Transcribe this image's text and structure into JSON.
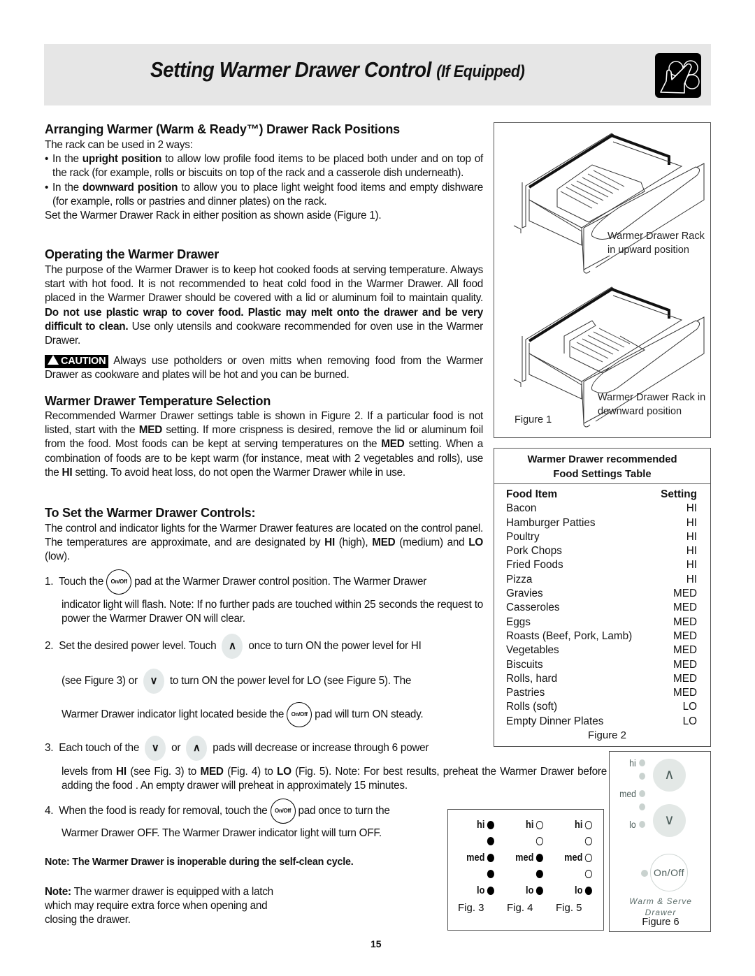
{
  "header": {
    "title_main": "Setting Warmer Drawer Control",
    "title_suffix": "(If Equipped)",
    "icon": "hand-touch-icon"
  },
  "section_rack": {
    "heading": "Arranging Warmer (Warm & Ready™) Drawer Rack Positions",
    "intro": "The rack can be used in 2 ways:",
    "bullet1_pre": "In the ",
    "bullet1_bold": "upright position",
    "bullet1_post": " to allow low profile food items to be placed both under and on top of the rack (for example, rolls or biscuits on top of the rack and a casserole dish underneath).",
    "bullet2_pre": "In the ",
    "bullet2_bold": "downward position",
    "bullet2_post": " to allow you to place light weight food items and empty dishware (for example, rolls or pastries and dinner plates) on the rack.",
    "closing": "Set the Warmer Drawer Rack in either position as shown aside (Figure 1)."
  },
  "section_operating": {
    "heading": "Operating the Warmer Drawer",
    "body_pre": "The purpose of the Warmer Drawer is to keep hot cooked foods at serving temperature. Always start with hot food. It is not recommended to heat cold food in the Warmer Drawer. All food placed in the Warmer Drawer should be covered with a lid or aluminum foil to maintain quality. ",
    "body_bold": "Do not use plastic wrap to cover food. Plastic may melt onto the drawer and be very difficult to clean.",
    "body_post": " Use only utensils and cookware recommended for oven use in the Warmer Drawer.",
    "caution_label": "CAUTION",
    "caution_text": " Always use potholders or oven mitts when removing food from the Warmer Drawer as cookware and plates will be hot and you can be burned."
  },
  "section_temperature": {
    "heading": "Warmer Drawer Temperature Selection",
    "t1": "Recommended Warmer Drawer settings table is shown in Figure 2. If a particular food is not listed, start with the ",
    "b1": "MED",
    "t2": " setting. If more crispness is desired, remove the lid or aluminum foil from the food. Most foods can be kept at serving temperatures on the ",
    "b2": "MED",
    "t3": " setting. When a combination of foods are to be kept warm (for instance, meat with 2 vegetables and rolls), use the ",
    "b3": "HI",
    "t4": " setting. To avoid heat loss, do not open the Warmer Drawer while in use."
  },
  "section_controls": {
    "heading": "To Set the Warmer Drawer Controls:",
    "t1": "The control and indicator lights for the Warmer Drawer features are located on the control panel. The temperatures are approximate, and are designated by ",
    "b1": "HI",
    "t2": " (high), ",
    "b2": "MED",
    "t3": " (medium) and ",
    "b3": "LO",
    "t4": " (low).",
    "onoff_pad": "On/Off",
    "up_pad": "∧",
    "down_pad": "∨",
    "step1_num": "1.",
    "step1_a": "Touch the ",
    "step1_b": " pad at the Warmer Drawer control position. The Warmer Drawer",
    "step1_c": "indicator light will flash. Note: If no further pads are touched within 25 seconds the request to power the Warmer Drawer ON will clear.",
    "step2_num": "2.",
    "step2_a": "Set the desired power level. Touch",
    "step2_b": "once to turn ON the power level for HI",
    "step2_c": "(see Figure 3) or",
    "step2_d": "to turn ON the power level for LO (see Figure 5). The",
    "step2_e": "Warmer Drawer indicator light located beside the ",
    "step2_f": " pad will turn ON steady.",
    "step3_num": "3.",
    "step3_a": "Each touch of the",
    "step3_b": "or",
    "step3_c": "pads will decrease or increase through 6 power",
    "step3_d1": "levels from ",
    "step3_hi": "HI",
    "step3_d2": " (see Fig. 3) to ",
    "step3_med": "MED",
    "step3_d3": " (Fig. 4) to ",
    "step3_lo": "LO",
    "step3_d4": " (Fig. 5). Note: For best results, preheat the Warmer Drawer before adding the food . An empty drawer will preheat in approximately 15 minutes.",
    "step4_num": "4.",
    "step4_a": "When the food is ready for removal, touch the ",
    "step4_b": " pad once to turn the",
    "step4_c": "Warmer Drawer  OFF. The Warmer Drawer indicator light will turn OFF."
  },
  "notes": {
    "self_clean": "Note: The Warmer Drawer is inoperable during the self-clean cycle.",
    "latch_bold": "Note:",
    "latch_text": " The warmer drawer is equipped with a latch which may require extra force when opening and closing the drawer."
  },
  "figure1": {
    "caption_upward": "Warmer Drawer Rack in upward position",
    "caption_downward": "Warmer Drawer Rack in downward position",
    "label": "Figure 1"
  },
  "figure2": {
    "title_line1": "Warmer Drawer recommended",
    "title_line2": "Food Settings Table",
    "col_food": "Food Item",
    "col_setting": "Setting",
    "rows": [
      {
        "food": "Bacon",
        "setting": "HI"
      },
      {
        "food": "Hamburger Patties",
        "setting": "HI"
      },
      {
        "food": "Poultry",
        "setting": "HI"
      },
      {
        "food": "Pork Chops",
        "setting": "HI"
      },
      {
        "food": "Fried Foods",
        "setting": "HI"
      },
      {
        "food": "Pizza",
        "setting": "HI"
      },
      {
        "food": "Gravies",
        "setting": "MED"
      },
      {
        "food": "Casseroles",
        "setting": "MED"
      },
      {
        "food": "Eggs",
        "setting": "MED"
      },
      {
        "food": "Roasts (Beef, Pork, Lamb)",
        "setting": "MED"
      },
      {
        "food": "Vegetables",
        "setting": "MED"
      },
      {
        "food": "Biscuits",
        "setting": "MED"
      },
      {
        "food": "Rolls, hard",
        "setting": "MED"
      },
      {
        "food": "Pastries",
        "setting": "MED"
      },
      {
        "food": "Rolls (soft)",
        "setting": "LO"
      },
      {
        "food": "Empty Dinner Plates",
        "setting": "LO"
      }
    ],
    "label": "Figure 2"
  },
  "figures_3_5": {
    "level_labels": [
      "hi",
      "",
      "med",
      "",
      "lo"
    ],
    "figs": [
      {
        "label": "Fig. 3",
        "lights_on": [
          true,
          true,
          true,
          true,
          true
        ]
      },
      {
        "label": "Fig. 4",
        "lights_on": [
          false,
          false,
          true,
          true,
          true
        ]
      },
      {
        "label": "Fig. 5",
        "lights_on": [
          false,
          false,
          false,
          false,
          true
        ]
      }
    ]
  },
  "figure6": {
    "hi": "hi",
    "med": "med",
    "lo": "lo",
    "up": "∧",
    "down": "∨",
    "onoff": "On/Off",
    "brand_line1": "Warm & Serve",
    "brand_line2": "Drawer",
    "label": "Figure 6"
  },
  "page_number": "15"
}
